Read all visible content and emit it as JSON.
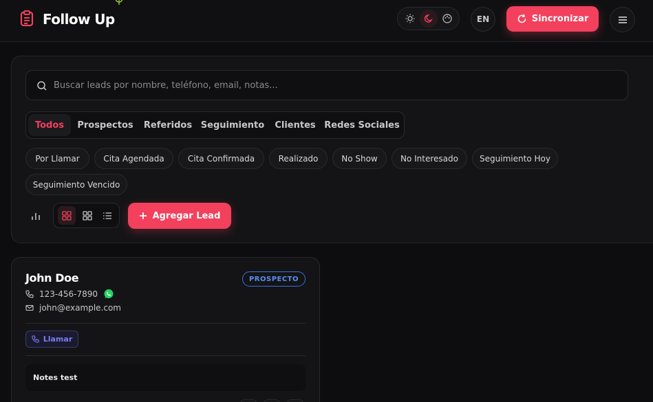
{
  "app": {
    "title": "Follow Up"
  },
  "header": {
    "theme_options": [
      "light-icon",
      "dark-icon",
      "palette-icon"
    ],
    "active_theme": "dark",
    "lang_label": "EN",
    "sync_label": "Sincronizar"
  },
  "search": {
    "placeholder": "Buscar leads por nombre, teléfono, email, notas...",
    "value": ""
  },
  "tabs": [
    {
      "label": "Todos",
      "active": true
    },
    {
      "label": "Prospectos"
    },
    {
      "label": "Referidos"
    },
    {
      "label": "Seguimiento"
    },
    {
      "label": "Clientes"
    },
    {
      "label": "Redes Sociales"
    }
  ],
  "status_filters": [
    "Por Llamar",
    "Cita Agendada",
    "Cita Confirmada",
    "Realizado",
    "No Show",
    "No Interesado",
    "Seguimiento Hoy",
    "Seguimiento Vencido"
  ],
  "toolbar": {
    "add_label": "Agregar Lead",
    "view_modes": [
      "grid-large",
      "grid",
      "list"
    ],
    "active_view": "grid-large"
  },
  "lead": {
    "name": "John Doe",
    "badge": "PROSPECTO",
    "phone": "123-456-7890",
    "email": "john@example.com",
    "call_label": "Llamar",
    "notes": "Notes test"
  },
  "colors": {
    "accent": "#f2405d",
    "badge_blue": "#3b6fd8",
    "call_purple": "#7a7cf0",
    "whatsapp": "#25d366"
  }
}
